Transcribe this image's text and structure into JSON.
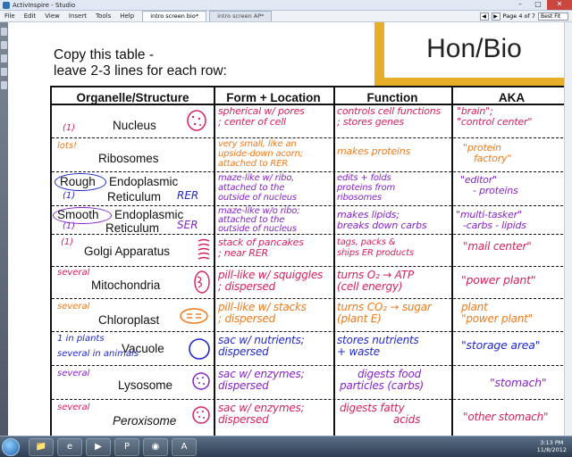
{
  "window": {
    "title": "ActivInspire - Studio"
  },
  "menu": [
    "File",
    "Edit",
    "View",
    "Insert",
    "Tools",
    "Help"
  ],
  "tabs": [
    {
      "label": "intro screen bio*",
      "active": true
    },
    {
      "label": "intro screen AP*",
      "active": false
    }
  ],
  "page_controls": {
    "page_text": "Page 4 of 7",
    "zoom": "Best Fit"
  },
  "slide": {
    "badge": "Hon/Bio",
    "instructions_line1": "Copy this table -",
    "instructions_line2": "leave 2-3 lines for each row:",
    "headers": [
      "Organelle/Structure",
      "Form + Location",
      "Function",
      "AKA"
    ],
    "rows": [
      {
        "count": "(1)",
        "name": "Nucleus",
        "form": [
          "spherical w/ pores",
          "; center of cell"
        ],
        "function": [
          "controls cell functions",
          "; stores genes"
        ],
        "aka": [
          "\"brain\";",
          "\"control center\""
        ]
      },
      {
        "count": "lots!",
        "name": "Ribosomes",
        "form": [
          "very small, like an",
          "upside-down acorn;",
          "attached to RER"
        ],
        "function": [
          "makes proteins"
        ],
        "aka": [
          "\"protein",
          "factory\""
        ]
      },
      {
        "count": "(1)",
        "name_part1": "Rough",
        "name_part2": "Endoplasmic",
        "name_part3": "Reticulum",
        "tag": "RER",
        "form": [
          "maze-like w/ ribo,",
          "attached to the",
          "outside of nucleus"
        ],
        "function": [
          "edits + folds",
          "proteins from",
          "ribosomes"
        ],
        "aka": [
          "\"editor\"",
          "- proteins"
        ]
      },
      {
        "count": "(1)",
        "name_part1": "Smooth",
        "name_part2": "Endoplasmic",
        "name_part3": "Reticulum",
        "tag": "SER",
        "form": [
          "maze-like w/o ribo;",
          "attached to the",
          "outside of nucleus"
        ],
        "function": [
          "makes lipids;",
          "breaks down carbs"
        ],
        "aka": [
          "\"multi-tasker\"",
          "-carbs - lipids"
        ]
      },
      {
        "count": "(1)",
        "name": "Golgi Apparatus",
        "form": [
          "stack of pancakes",
          "; near RER"
        ],
        "function": [
          "tags, packs &",
          "ships ER products"
        ],
        "aka": [
          "\"mail center\""
        ]
      },
      {
        "count": "several",
        "name": "Mitochondria",
        "form": [
          "pill-like w/ squiggles",
          "; dispersed"
        ],
        "function": [
          "turns O₂ → ATP",
          "(cell energy)"
        ],
        "aka": [
          "\"power plant\""
        ]
      },
      {
        "count": "several",
        "name": "Chloroplast",
        "form": [
          "pill-like w/ stacks",
          "; dispersed"
        ],
        "function": [
          "turns CO₂ → sugar",
          "(plant E)"
        ],
        "aka": [
          "plant",
          "\"power plant\""
        ]
      },
      {
        "count": "1 in plants / several in animals",
        "count_line1": "1 in plants",
        "count_line2": "several in animals",
        "name": "Vacuole",
        "form": [
          "sac w/ nutrients;",
          "dispersed"
        ],
        "function": [
          "stores nutrients",
          "+ waste"
        ],
        "aka": [
          "\"storage area\""
        ]
      },
      {
        "count": "several",
        "name": "Lysosome",
        "form": [
          "sac w/ enzymes;",
          "dispersed"
        ],
        "function": [
          "digests food",
          "particles (carbs)"
        ],
        "aka": [
          "\"stomach\""
        ]
      },
      {
        "count": "several",
        "name": "Peroxisome",
        "form": [
          "sac w/ enzymes;",
          "dispersed"
        ],
        "function": [
          "digests fatty",
          "acids"
        ],
        "aka": [
          "\"other stomach\""
        ]
      }
    ]
  },
  "taskbar": {
    "time": "3:13 PM",
    "date": "11/8/2012"
  },
  "colors": {
    "accent_gold": "#e7ae29",
    "ink_red": "#d6225a",
    "ink_purple": "#8624c8",
    "ink_orange": "#f07a1c",
    "ink_blue": "#2129c8"
  }
}
